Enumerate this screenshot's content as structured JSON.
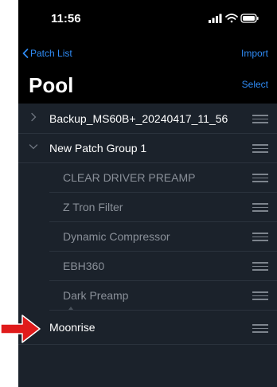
{
  "status_bar": {
    "time": "11:56"
  },
  "nav": {
    "back_label": "Patch List",
    "import_label": "Import",
    "select_label": "Select",
    "title": "Pool"
  },
  "rows": [
    {
      "label": "Backup_MS60B+_20240417_11_56",
      "level": "top",
      "chevron": "right"
    },
    {
      "label": "New Patch Group 1",
      "level": "top",
      "chevron": "down"
    },
    {
      "label": "CLEAR DRIVER PREAMP",
      "level": "child"
    },
    {
      "label": "Z Tron Filter",
      "level": "child"
    },
    {
      "label": "Dynamic Compressor",
      "level": "child"
    },
    {
      "label": "EBH360",
      "level": "child"
    },
    {
      "label": "Dark Preamp",
      "level": "child"
    }
  ],
  "dragged_row": {
    "label": "Moonrise"
  },
  "colors": {
    "accent": "#2f8bf5",
    "background": "#1b222b",
    "header": "#000000",
    "arrow": "#e01b1b"
  },
  "icons": [
    "chevron-left-icon",
    "signal-icon",
    "wifi-icon",
    "battery-icon",
    "chevron-right-icon",
    "chevron-down-icon",
    "reorder-handle-icon",
    "red-arrow-icon"
  ]
}
